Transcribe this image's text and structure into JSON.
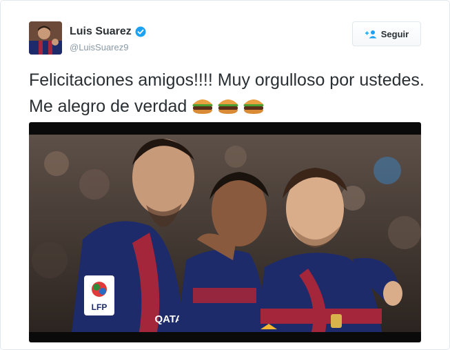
{
  "tweet": {
    "author_name": "Luis Suarez",
    "author_handle": "@LuisSuarez9",
    "follow_label": "Seguir",
    "text": "Felicitaciones amigos!!!! Muy orgulloso por ustedes. Me alegro de verdad",
    "emoji": [
      "hamburger",
      "hamburger",
      "hamburger"
    ],
    "media": {
      "badge_text": "LFP",
      "jersey_text": "QATAR"
    }
  },
  "colors": {
    "verified": "#1da1f2",
    "follow_icon": "#1da1f2",
    "jersey_blue": "#1d2b6b",
    "jersey_red": "#a4263a"
  },
  "icons": {
    "verified": "verified-badge-icon",
    "follow": "add-user-icon",
    "emoji": "hamburger-emoji-icon"
  }
}
